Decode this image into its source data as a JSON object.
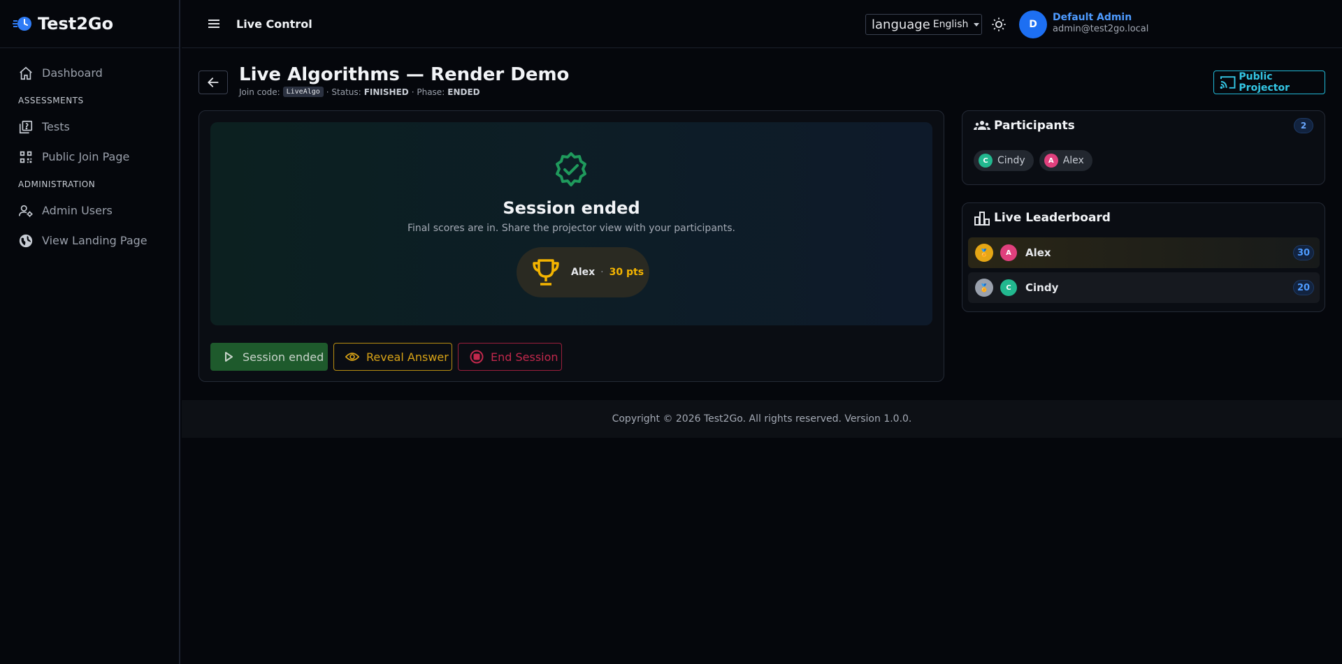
{
  "app": {
    "name": "Test2Go"
  },
  "sidebar": {
    "items": [
      {
        "label": "Dashboard"
      },
      {
        "section": "ASSESSMENTS"
      },
      {
        "label": "Tests"
      },
      {
        "label": "Public Join Page"
      },
      {
        "section": "ADMINISTRATION"
      },
      {
        "label": "Admin Users"
      },
      {
        "label": "View Landing Page"
      }
    ]
  },
  "header": {
    "title": "Live Control",
    "language_label": "language",
    "language_value": "English",
    "user": {
      "initial": "D",
      "name": "Default Admin",
      "email": "admin@test2go.local"
    }
  },
  "page": {
    "title": "Live Algorithms — Render Demo",
    "join_label": "Join code:",
    "join_code": "LiveAlgo",
    "status_label": "· Status:",
    "status_value": "FINISHED",
    "phase_label": "· Phase:",
    "phase_value": "ENDED",
    "projector_label": "Public Projector"
  },
  "session": {
    "title": "Session ended",
    "subtitle": "Final scores are in. Share the projector view with your participants.",
    "winner_name": "Alex",
    "winner_separator": "·",
    "winner_points": "30 pts"
  },
  "actions": {
    "session_ended": "Session ended",
    "reveal_answer": "Reveal Answer",
    "end_session": "End Session"
  },
  "participants": {
    "title": "Participants",
    "count": "2",
    "list": [
      {
        "initial": "C",
        "name": "Cindy",
        "color": "#22b88f"
      },
      {
        "initial": "A",
        "name": "Alex",
        "color": "#e0407d"
      }
    ]
  },
  "leaderboard": {
    "title": "Live Leaderboard",
    "rows": [
      {
        "rank_medal": "gold",
        "initial": "A",
        "name": "Alex",
        "score": "30",
        "color": "#e0407d"
      },
      {
        "rank_medal": "silver",
        "initial": "C",
        "name": "Cindy",
        "score": "20",
        "color": "#22b88f"
      }
    ]
  },
  "footer": {
    "text": "Copyright © 2026 Test2Go. All rights reserved. Version 1.0.0."
  },
  "colors": {
    "accent": "#1d6ff2",
    "cyan": "#21b8d6",
    "gold": "#f4b400",
    "success": "#1e5a2c",
    "danger": "#c2284c"
  }
}
